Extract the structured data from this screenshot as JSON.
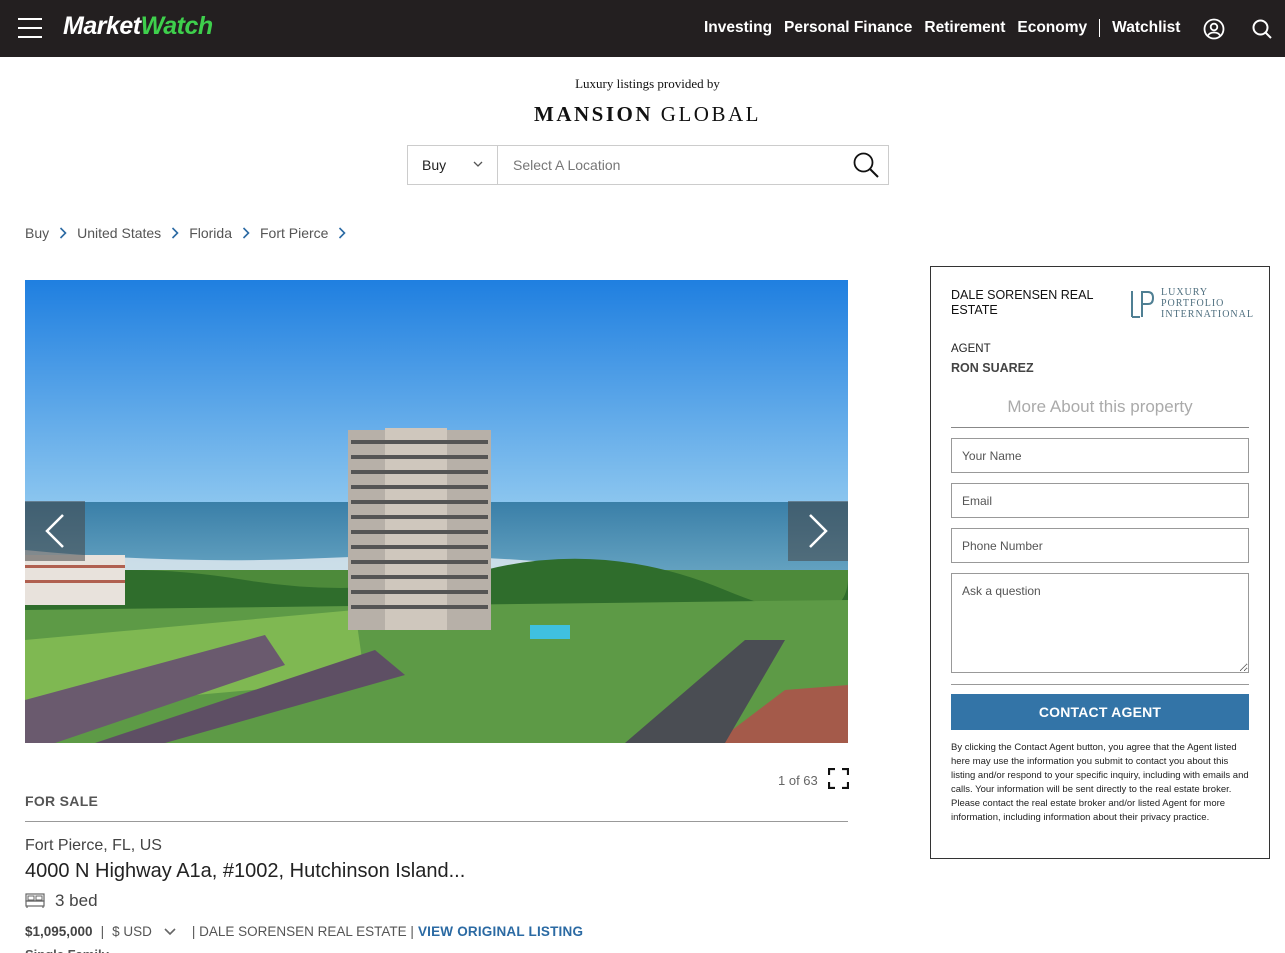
{
  "header": {
    "logo_part1": "Market",
    "logo_part2": "Watch",
    "nav": [
      "Investing",
      "Personal Finance",
      "Retirement",
      "Economy",
      "Watchlist"
    ],
    "icons": [
      "hamburger-icon",
      "user-icon",
      "search-icon"
    ]
  },
  "provider": {
    "provided_by": "Luxury listings provided by",
    "brand_bold": "MANSION",
    "brand_light": " GLOBAL"
  },
  "search": {
    "type_value": "Buy",
    "placeholder": "Select A Location"
  },
  "breadcrumb": [
    "Buy",
    "United States",
    "Florida",
    "Fort Pierce"
  ],
  "gallery": {
    "counter": "1 of 63"
  },
  "listing": {
    "status": "FOR SALE",
    "location": "Fort Pierce, FL, US",
    "address": "4000 N Highway A1a, #1002, Hutchinson Island...",
    "beds": "3 bed",
    "price": "$1,095,000",
    "currency": "$ USD",
    "brokerage": "| DALE SORENSEN REAL ESTATE |",
    "view_link": "VIEW ORIGINAL LISTING",
    "property_type": "Single Family Home"
  },
  "agent_panel": {
    "brokerage": "DALE SORENSEN REAL ESTATE",
    "network_lines": [
      "LUXURY",
      "PORTFOLIO",
      "INTERNATIONAL"
    ],
    "agent_label": "AGENT",
    "agent_name": "RON SUAREZ",
    "more_title": "More About this property",
    "name_placeholder": "Your Name",
    "email_placeholder": "Email",
    "phone_placeholder": "Phone Number",
    "question_placeholder": "Ask a question",
    "button_label": "CONTACT AGENT",
    "disclaimer": "By clicking the Contact Agent button, you agree that the Agent listed here may use the information you submit to contact you about this listing and/or respond to your specific inquiry, including with emails and calls. Your information will be sent directly to the real estate broker. Please contact the real estate broker and/or listed Agent for more information, including information about their privacy practice."
  },
  "colors": {
    "header_bg": "#231f20",
    "logo_accent": "#3ecf4c",
    "button_blue": "#3374a7",
    "link_blue": "#2b6aa3"
  }
}
